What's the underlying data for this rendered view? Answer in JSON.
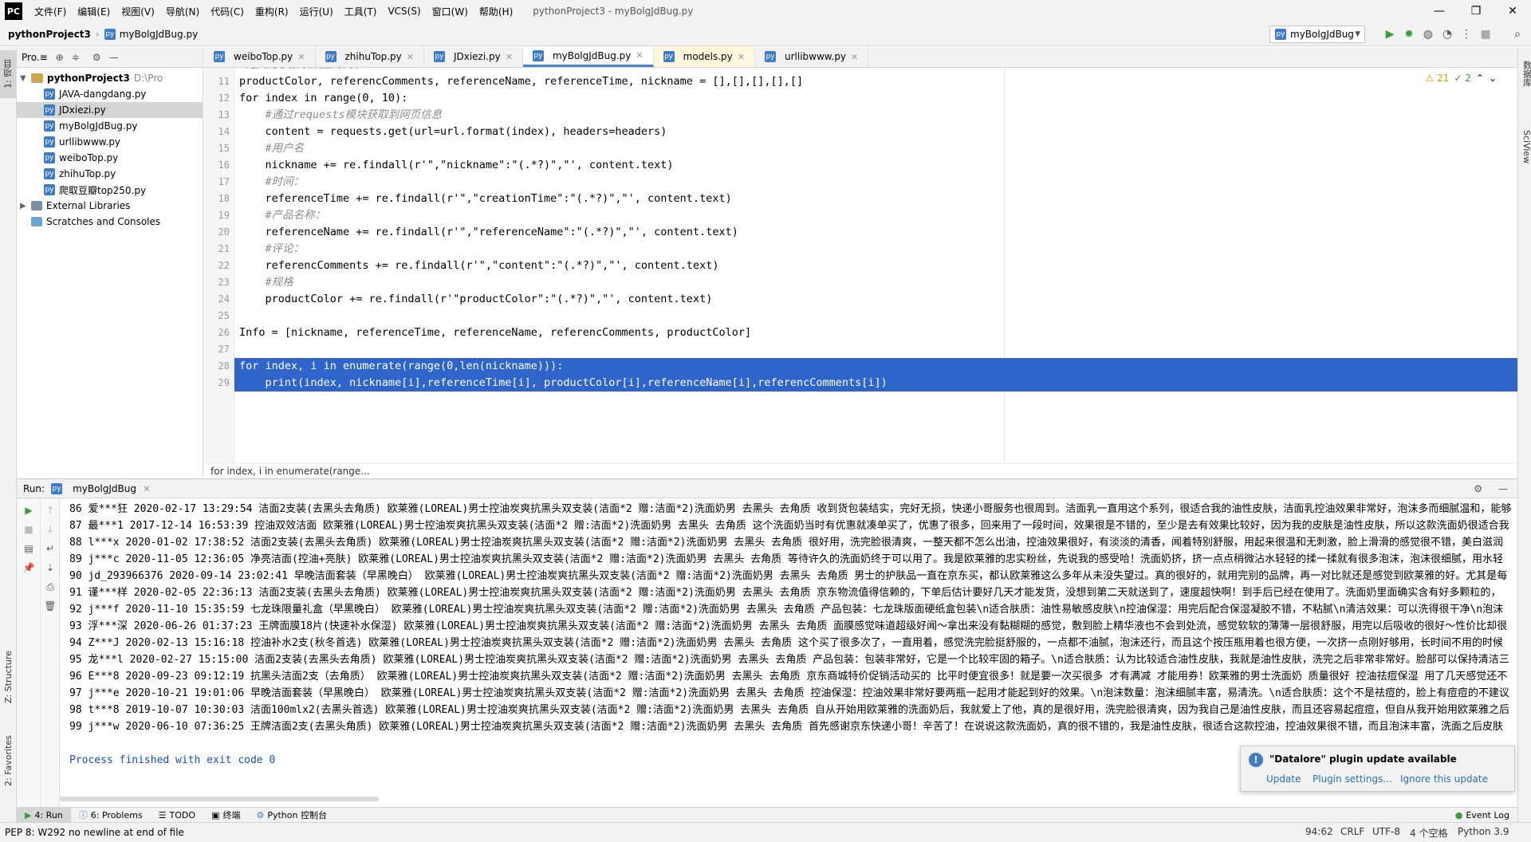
{
  "menubar": {
    "logo": "PC",
    "items": [
      "文件(F)",
      "编辑(E)",
      "视图(V)",
      "导航(N)",
      "代码(C)",
      "重构(R)",
      "运行(U)",
      "工具(T)",
      "VCS(S)",
      "窗口(W)",
      "帮助(H)"
    ],
    "window_title": "pythonProject3 - myBolgJdBug.py"
  },
  "navbar": {
    "project": "pythonProject3",
    "file": "myBolgJdBug.py",
    "run_config": "myBolgJdBug"
  },
  "left_strip": {
    "project_tab": "1: 项目",
    "structure_tab": "Z: Structure",
    "favorites_tab": "2: Favorites"
  },
  "right_strip": {
    "db_tab": "数据库",
    "sciview_tab": "SciView"
  },
  "project_panel": {
    "title": "Pro.≡",
    "root": "pythonProject3",
    "root_path": "D:\\Pro",
    "files": [
      "JAVA-dangdang.py",
      "JDxiezi.py",
      "myBolgJdBug.py",
      "urllibwww.py",
      "weiboTop.py",
      "zhihuTop.py",
      "爬取豆瓣top250.py"
    ],
    "external": "External Libraries",
    "scratches": "Scratches and Consoles"
  },
  "editor_tabs": [
    "weiboTop.py",
    "zhihuTop.py",
    "JDxiezi.py",
    "myBolgJdBug.py",
    "models.py",
    "urllibwww.py"
  ],
  "inspection": {
    "warnings": "⚠ 21",
    "weak": "✓ 2"
  },
  "code": [
    {
      "num": "10",
      "text": "#定义用于接收数据的列表",
      "kind": "comment"
    },
    {
      "num": "11",
      "text": "productColor, referencComments, referenceName, referenceTime, nickname = [],[],[],[],[]",
      "kind": "code"
    },
    {
      "num": "12",
      "text": "for index in range(0, 10):",
      "kind": "code"
    },
    {
      "num": "13",
      "text": "    #通过requests模块获取到网页信息",
      "kind": "comment"
    },
    {
      "num": "14",
      "text": "    content = requests.get(url=url.format(index), headers=headers)",
      "kind": "code"
    },
    {
      "num": "15",
      "text": "    #用户名",
      "kind": "comment"
    },
    {
      "num": "16",
      "text": "    nickname += re.findall(r'\",\"nickname\":\"(.*?)\",\"', content.text)",
      "kind": "code"
    },
    {
      "num": "17",
      "text": "    #时间：",
      "kind": "comment"
    },
    {
      "num": "18",
      "text": "    referenceTime += re.findall(r'\",\"creationTime\":\"(.*?)\",\"', content.text)",
      "kind": "code"
    },
    {
      "num": "19",
      "text": "    #产品名称：",
      "kind": "comment"
    },
    {
      "num": "20",
      "text": "    referenceName += re.findall(r'\",\"referenceName\":\"(.*?)\",\"', content.text)",
      "kind": "code"
    },
    {
      "num": "21",
      "text": "    #评论：",
      "kind": "comment"
    },
    {
      "num": "22",
      "text": "    referencComments += re.findall(r'\",\"content\":\"(.*?)\",\"', content.text)",
      "kind": "code"
    },
    {
      "num": "23",
      "text": "    #规格",
      "kind": "comment"
    },
    {
      "num": "24",
      "text": "    productColor += re.findall(r'\"productColor\":\"(.*?)\",\"', content.text)",
      "kind": "code"
    },
    {
      "num": "25",
      "text": "",
      "kind": "code"
    },
    {
      "num": "26",
      "text": "Info = [nickname, referenceTime, referenceName, referencComments, productColor]",
      "kind": "code"
    },
    {
      "num": "27",
      "text": "",
      "kind": "code"
    },
    {
      "num": "28",
      "text": "for index, i in enumerate(range(0,len(nickname))):",
      "kind": "sel"
    },
    {
      "num": "29",
      "text": "    print(index, nickname[i],referenceTime[i], productColor[i],referenceName[i],referencComments[i])",
      "kind": "sel"
    }
  ],
  "breadcrumb": "for index, i in enumerate(range...",
  "run_panel": {
    "label": "Run:",
    "tab": "myBolgJdBug",
    "output": [
      "86 爱***狂 2020-02-17 13:29:54 洁面2支装(去黑头去角质) 欧莱雅(LOREAL)男士控油炭爽抗黑头双支装(洁面*2 赠:洁面*2)洗面奶男 去黑头 去角质 收到货包装结实，完好无损，快递小哥服务也很周到。洁面乳一直用这个系列，很适合我的油性皮肤，洁面乳控油效果非常好，泡沫多而细腻温和，能够",
      "87 最***1 2017-12-14 16:53:39 控油双效洁面 欧莱雅(LOREAL)男士控油炭爽抗黑头双支装(洁面*2 赠:洁面*2)洗面奶男 去黑头 去角质 这个洗面奶当时有优惠就凑单买了，优惠了很多，回来用了一段时间，效果很是不错的，至少是去有效果比较好，因为我的皮肤是油性皮肤，所以这款洗面奶很适合我",
      "88 l***x 2020-01-02 17:38:52 洁面2支装(去黑头去角质) 欧莱雅(LOREAL)男士控油炭爽抗黑头双支装(洁面*2 赠:洁面*2)洗面奶男 去黑头 去角质 很好用，洗完脸很清爽，一整天都不怎么出油，控油效果很好，有淡淡的清香，闻着特别舒服，用起来很温和无刺激，脸上滑滑的感觉很不错，美白滋润",
      "89 j***c 2020-11-05 12:36:05 净亮洁面(控油+亮肤) 欧莱雅(LOREAL)男士控油炭爽抗黑头双支装(洁面*2 赠:洁面*2)洗面奶男 去黑头 去角质 等待许久的洗面奶终于可以用了。我是欧莱雅的忠实粉丝，先说我的感受哈！洗面奶挤，挤一点点稍微沾水轻轻的揉一揉就有很多泡沫，泡沫很细腻，用水轻",
      "90 jd_293966376 2020-09-14 23:02:41 早晚洁面套装（早黑晚白） 欧莱雅(LOREAL)男士控油炭爽抗黑头双支装(洁面*2 赠:洁面*2)洗面奶男 去黑头 去角质 男士的护肤品一直在京东买，都认欧莱雅这么多年从未没失望过。真的很好的，就用完别的品牌，再一对比就还是感觉到欧莱雅的好。尤其是每",
      "91 谨***样 2020-02-05 22:36:13 洁面2支装(去黑头去角质) 欧莱雅(LOREAL)男士控油炭爽抗黑头双支装(洁面*2 赠:洁面*2)洗面奶男 去黑头 去角质 京东物流值得信赖的，下单后估计要好几天才能发货，没想到第二天就送到了，速度超快啊！到手后已经在使用了。洗面奶里面确实含有好多颗粒的，",
      "92 j***f 2020-11-10 15:35:59 七龙珠限量礼盒（早黑晚白） 欧莱雅(LOREAL)男士控油炭爽抗黑头双支装(洁面*2 赠:洁面*2)洗面奶男 去黑头 去角质 产品包装：七龙珠版面硬纸盒包装\\n适合肤质：油性易敏感皮肤\\n控油保湿：用完后配合保湿凝胶不错，不粘腻\\n清洁效果：可以洗得很干净\\n泡沫",
      "93 浮***深 2020-06-26 01:37:23 王牌面膜18片(快速补水保湿) 欧莱雅(LOREAL)男士控油炭爽抗黑头双支装(洁面*2 赠:洁面*2)洗面奶男 去黑头 去角质 面膜感觉味道超级好闻～拿出来没有黏糊糊的感觉，敷到脸上精华液也不会到处流，感觉软软的薄薄一层很舒服，用完以后吸收的很好～性价比却很",
      "94 Z***J 2020-02-13 15:16:18 控油补水2支(秋冬首选) 欧莱雅(LOREAL)男士控油炭爽抗黑头双支装(洁面*2 赠:洁面*2)洗面奶男 去黑头 去角质 这个买了很多次了，一直用着，感觉洗完脸挺舒服的，一点都不油腻，泡沫还行，而且这个按压瓶用着也很方便，一次挤一点刚好够用，长时间不用的时候",
      "95 龙***l 2020-02-27 15:15:00 洁面2支装(去黑头去角质) 欧莱雅(LOREAL)男士控油炭爽抗黑头双支装(洁面*2 赠:洁面*2)洗面奶男 去黑头 去角质 产品包装：包装非常好，它是一个比较牢固的箱子。\\n适合肤质：认为比较适合油性皮肤，我就是油性皮肤，洗完之后非常非常好。脸部可以保持清洁三",
      "96 E***8 2020-09-23 09:12:19 抗黑头洁面2支（去角质） 欧莱雅(LOREAL)男士控油炭爽抗黑头双支装(洁面*2 赠:洁面*2)洗面奶男 去黑头 去角质 京东商城特价促销活动买的 比平时便宜很多！就是要一次买很多 才有满减 才能用券！欧莱雅的男士洗面奶 质量很好 控油祛痘保湿 用了几天感觉还不",
      "97 j***e 2020-10-21 19:01:06 早晚洁面套装（早黑晚白） 欧莱雅(LOREAL)男士控油炭爽抗黑头双支装(洁面*2 赠:洁面*2)洗面奶男 去黑头 去角质 控油保湿：控油效果非常好要两瓶一起用才能起到好的效果。\\n泡沫数量：泡沫细腻丰富，易清洗。\\n适合肤质：这个不是祛痘的，脸上有痘痘的不建议",
      "98 t***8 2019-10-07 10:30:03 洁面100mlx2(去黑头首选) 欧莱雅(LOREAL)男士控油炭爽抗黑头双支装(洁面*2 赠:洁面*2)洗面奶男 去黑头 去角质 自从开始用欧莱雅的洗面奶后，我就爱上了他，真的是很好用，洗完脸很清爽，因为我自己是油性皮肤，而且还容易起痘痘，但自从我开始用欧莱雅之后",
      "99 j***w 2020-06-10 07:36:25 王牌洁面2支(去黑头角质) 欧莱雅(LOREAL)男士控油炭爽抗黑头双支装(洁面*2 赠:洁面*2)洗面奶男 去黑头 去角质 首先感谢京东快递小哥！辛苦了！在说说这款洗面奶，真的很不错的，我是油性皮肤，很适合这款控油，控油效果很不错，而且泡沫丰富，洗面之后皮肤"
    ],
    "exit": "Process finished with exit code 0"
  },
  "notification": {
    "title": "\"Datalore\" plugin update available",
    "update": "Update",
    "settings": "Plugin settings...",
    "ignore": "Ignore this update"
  },
  "bottom_tabs": [
    "4: Run",
    "6: Problems",
    "TODO",
    "终端",
    "Python 控制台"
  ],
  "event_log": "Event Log",
  "status": {
    "message": "PEP 8: W292 no newline at end of file",
    "position": "94:62",
    "line_sep": "CRLF",
    "encoding": "UTF-8",
    "indent": "4 个空格",
    "interpreter": "Python 3.9"
  }
}
